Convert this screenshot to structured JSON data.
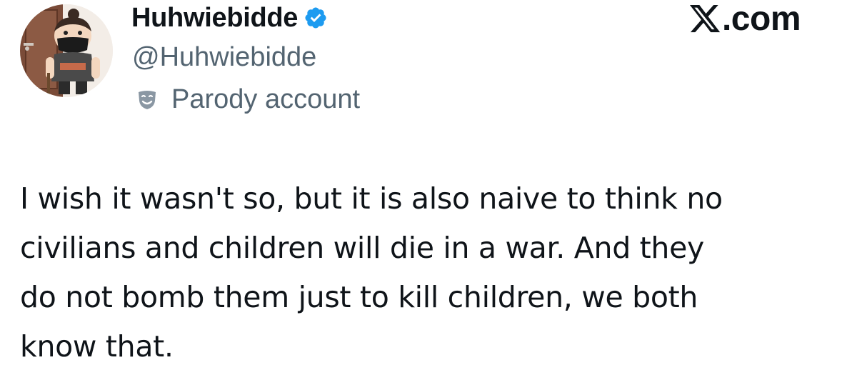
{
  "author": {
    "display_name": "Huhwiebidde",
    "handle": "@Huhwiebidde",
    "verified": true,
    "verified_icon": "verified-badge-icon",
    "verified_color": "#1d9bf0",
    "parody_label": "Parody account",
    "parody_icon": "theater-mask-icon",
    "avatar_icon": "cartoon-avatar-icon"
  },
  "brand": {
    "logo_icon": "x-logo-icon",
    "text": ".com"
  },
  "tweet": {
    "lines": [
      "I wish it wasn't so, but it is also naive to think no",
      "civilians and children will die in a war. And they",
      "do not bomb them just to kill children, we both",
      "know that."
    ]
  },
  "colors": {
    "text_primary": "#0f1419",
    "text_secondary": "#536471",
    "background": "#ffffff"
  }
}
